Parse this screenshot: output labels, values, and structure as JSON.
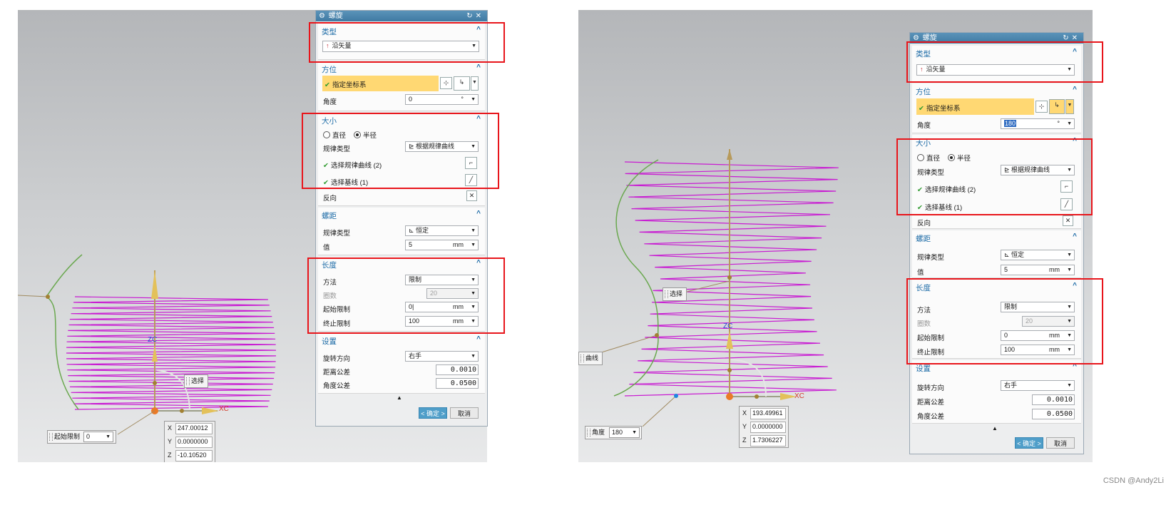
{
  "dialog": {
    "title": "螺旋",
    "type_section": {
      "header": "类型",
      "value": "沿矢量"
    },
    "orientation_section": {
      "header": "方位",
      "specify_csys": "指定坐标系",
      "angle_label": "角度"
    },
    "size_section": {
      "header": "大小",
      "diameter": "直径",
      "radius": "半径",
      "law_type_label": "规律类型",
      "law_type_value": "根据规律曲线",
      "select_law_curve": "选择规律曲线 (2)",
      "select_baseline": "选择基线 (1)",
      "reverse_label": "反向"
    },
    "pitch_section": {
      "header": "螺距",
      "law_type_label": "规律类型",
      "law_type_value": "恒定",
      "value_label": "值",
      "value": "5",
      "unit": "mm"
    },
    "length_section": {
      "header": "长度",
      "method_label": "方法",
      "method_value": "限制",
      "turns_label": "圈数",
      "turns_value": "20",
      "start_label": "起始限制",
      "start_value": "0",
      "end_label": "终止限制",
      "end_value": "100",
      "unit": "mm"
    },
    "settings_section": {
      "header": "设置",
      "rotation_label": "旋转方向",
      "rotation_value": "右手",
      "dist_tol_label": "距离公差",
      "dist_tol_value": "0.0010",
      "angle_tol_label": "角度公差",
      "angle_tol_value": "0.0500"
    },
    "ok_label": "< 确定 >",
    "cancel_label": "取消",
    "degree_unit": "°"
  },
  "left": {
    "angle_value": "0",
    "start_cursor": "0|",
    "tag_select": "选择",
    "tag_start": "起始限制",
    "start_tag_value": "0",
    "coords": {
      "x": "247.00012",
      "y": "0.0000000",
      "z": "-10.10520"
    },
    "axis_xc": "XC",
    "axis_zc": "ZC"
  },
  "right": {
    "angle_value": "180",
    "tag_select": "选择",
    "tag_curve": "曲线",
    "tag_angle": "角度",
    "angle_tag_value": "180",
    "coords": {
      "x": "193.49961",
      "y": "0.0000000",
      "z": "1.7306227"
    },
    "axis_xc": "XC",
    "axis_zc": "ZC"
  },
  "coord_keys": {
    "x": "X",
    "y": "Y",
    "z": "Z"
  },
  "icons": {
    "gear": "gear-icon",
    "reset": "reset-icon",
    "close": "close-icon",
    "collapse": "chevron-up-icon",
    "dropdown": "chevron-down-icon",
    "check": "check-icon",
    "vector": "vector-arrow-icon"
  },
  "colors": {
    "title_bar": "#4a86ae",
    "section_header": "#1b6aa6",
    "highlight": "#ffd873",
    "check": "#2d9a2d",
    "helix": "#c81cd2",
    "curve": "#6aa84f",
    "red_box": "#e8151b"
  },
  "watermark": "CSDN @Andy2Li"
}
